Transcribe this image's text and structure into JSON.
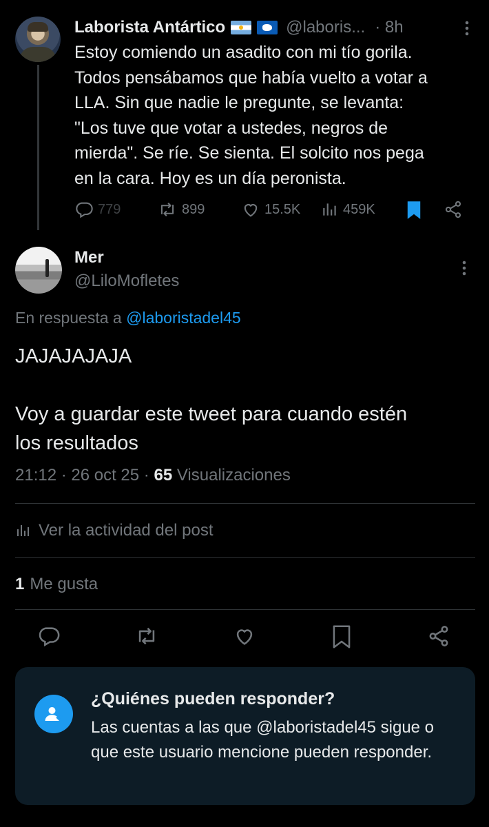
{
  "parent_tweet": {
    "display_name": "Laborista Antártico",
    "handle": "@laboris...",
    "time": "· 8h",
    "body": "Estoy comiendo un asadito con mi tío gorila.\nTodos pensábamos que había vuelto a votar a\nLLA. Sin que nadie le pregunte, se levanta:\n\"Los tuve que votar a ustedes, negros de\nmierda\". Se ríe. Se sienta. El solcito nos pega\nen la cara. Hoy es un día peronista.",
    "flags": [
      "flag-argentina-icon",
      "flag-antarctica-icon"
    ],
    "stats": {
      "replies": "779",
      "reposts": "899",
      "likes": "15.5K",
      "views": "459K"
    }
  },
  "reply_tweet": {
    "display_name": "Mer",
    "handle": "@LiloMofletes",
    "reply_prefix": "En respuesta a ",
    "reply_to": "@laboristadel45",
    "body": "JAJAJAJAJA\n\nVoy a guardar este tweet para cuando estén\nlos resultados",
    "time": "21:12 · 26 oct 25 ·",
    "views_count": "65",
    "views_label": "Visualizaciones",
    "activity_label": "Ver la actividad del post",
    "likes_count": "1",
    "likes_label": "Me gusta"
  },
  "reply_info_card": {
    "title": "¿Quiénes pueden responder?",
    "description": "Las cuentas a las que @laboristadel45 sigue o que este usuario mencione pueden responder."
  },
  "colors": {
    "background": "#000000",
    "text": "#e7e9ea",
    "muted": "#71767b",
    "accent": "#1d9bf0",
    "card": "#0d1c26"
  }
}
